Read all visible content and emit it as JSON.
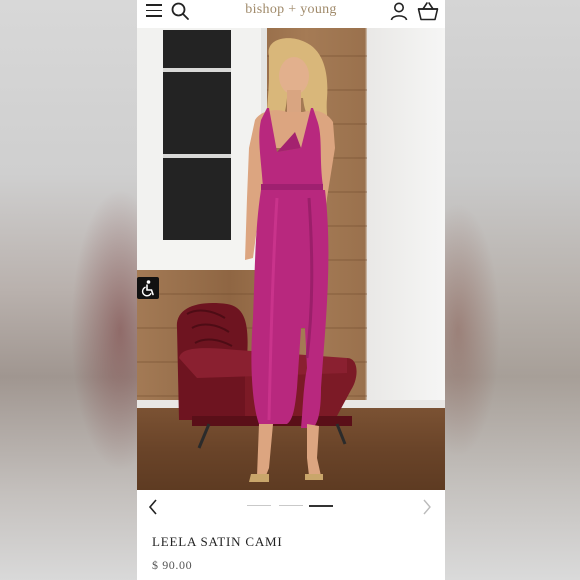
{
  "header": {
    "brand": "bishop + young",
    "menu_icon": "hamburger-menu-icon",
    "search_icon": "search-icon",
    "account_icon": "user-account-icon",
    "cart_icon": "shopping-basket-icon",
    "brand_color": "#a08a6a"
  },
  "hero": {
    "image_description_icon": "product-photo",
    "accessibility_icon": "accessibility-icon"
  },
  "carousel": {
    "slide_count": 3,
    "active_slide": 3,
    "prev_icon": "chevron-left-icon",
    "next_icon": "chevron-right-icon"
  },
  "product": {
    "title": "LEELA SATIN CAMI",
    "price": "$ 90.00"
  },
  "colors": {
    "dress": "#b8287e",
    "text": "#222222"
  }
}
